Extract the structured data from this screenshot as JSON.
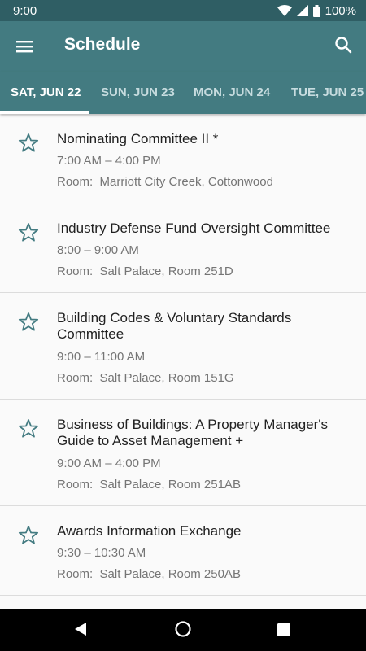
{
  "status": {
    "time": "9:00",
    "battery": "100%"
  },
  "app": {
    "title": "Schedule"
  },
  "tabs": [
    {
      "label": "SAT, JUN 22"
    },
    {
      "label": "SUN, JUN 23"
    },
    {
      "label": "MON, JUN 24"
    },
    {
      "label": "TUE, JUN 25"
    }
  ],
  "sessions": [
    {
      "title": "Nominating Committee II *",
      "time": "7:00 AM – 4:00 PM",
      "room": "Room:  Marriott City Creek, Cottonwood"
    },
    {
      "title": "Industry Defense Fund Oversight Committee",
      "time": "8:00 – 9:00 AM",
      "room": "Room:  Salt Palace, Room 251D"
    },
    {
      "title": "Building Codes & Voluntary Standards Committee",
      "time": "9:00 – 11:00 AM",
      "room": "Room:  Salt Palace, Room 151G"
    },
    {
      "title": "Business of Buildings: A Property Manager's Guide to Asset Management +",
      "time": "9:00 AM – 4:00 PM",
      "room": "Room:  Salt Palace, Room 251AB"
    },
    {
      "title": "Awards Information Exchange",
      "time": "9:30 – 10:30 AM",
      "room": "Room:  Salt Palace, Room 250AB"
    }
  ],
  "colors": {
    "status_bar": "#2f5e64",
    "app_bar": "#437b81",
    "star": "#437b81"
  },
  "icons": {
    "menu": "menu-icon",
    "search": "search-icon",
    "star": "star-outline-icon",
    "wifi": "wifi-icon",
    "signal": "signal-icon",
    "battery": "battery-icon",
    "back": "back-icon",
    "home": "home-icon",
    "recents": "recents-icon"
  }
}
